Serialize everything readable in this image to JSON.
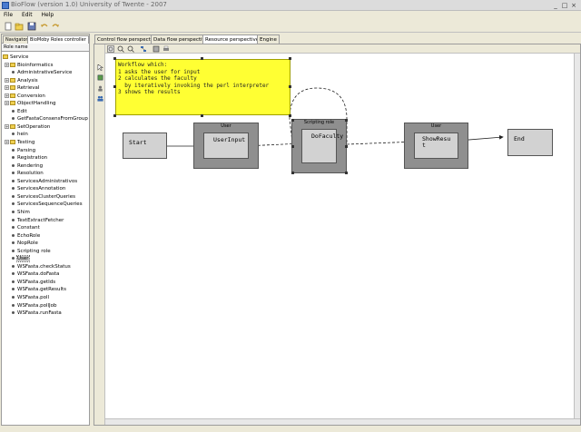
{
  "window": {
    "title": "BioFlow (version 1.0) University of Twente - 2007"
  },
  "menu": {
    "file": "File",
    "edit": "Edit",
    "help": "Help"
  },
  "left_tabs": {
    "navigator": "Navigator",
    "roles": "BioMoby Roles controller"
  },
  "tree": {
    "column_header": "Role name",
    "root": "Service",
    "items": [
      {
        "label": "Bioinformatics",
        "kind": "folder",
        "expandable": true
      },
      {
        "label": "AdministrativeService",
        "kind": "leaf"
      },
      {
        "label": "Analysis",
        "kind": "folder",
        "expandable": true
      },
      {
        "label": "Retrieval",
        "kind": "folder",
        "expandable": true
      },
      {
        "label": "Conversion",
        "kind": "folder",
        "expandable": true
      },
      {
        "label": "ObjectHandling",
        "kind": "folder",
        "expandable": true
      },
      {
        "label": "Edit",
        "kind": "leaf"
      },
      {
        "label": "GetFastaConsensFromGroup",
        "kind": "leaf"
      },
      {
        "label": "SetOperation",
        "kind": "folder",
        "expandable": true
      },
      {
        "label": "hein",
        "kind": "leaf"
      },
      {
        "label": "Testing",
        "kind": "folder",
        "expandable": true
      },
      {
        "label": "Parsing",
        "kind": "leaf"
      },
      {
        "label": "Registration",
        "kind": "leaf"
      },
      {
        "label": "Rendering",
        "kind": "leaf"
      },
      {
        "label": "Resolution",
        "kind": "leaf"
      },
      {
        "label": "ServicesAdministrativos",
        "kind": "leaf"
      },
      {
        "label": "ServicesAnnotation",
        "kind": "leaf"
      },
      {
        "label": "ServicesClusterQueries",
        "kind": "leaf"
      },
      {
        "label": "ServicesSequenceQueries",
        "kind": "leaf"
      },
      {
        "label": "Shim",
        "kind": "leaf"
      },
      {
        "label": "TextExtractFetcher",
        "kind": "leaf"
      },
      {
        "label": "Constant",
        "kind": "leaf"
      },
      {
        "label": "EchoRole",
        "kind": "leaf"
      },
      {
        "label": "NopRole",
        "kind": "leaf"
      },
      {
        "label": "Scripting role",
        "kind": "leaf"
      },
      {
        "label": "User",
        "kind": "leaf",
        "selected": true
      },
      {
        "label": "WSFasta.checkStatus",
        "kind": "leaf"
      },
      {
        "label": "WSFasta.doFasta",
        "kind": "leaf"
      },
      {
        "label": "WSFasta.getIds",
        "kind": "leaf"
      },
      {
        "label": "WSFasta.getResults",
        "kind": "leaf"
      },
      {
        "label": "WSFasta.poll",
        "kind": "leaf"
      },
      {
        "label": "WSFasta.pollJob",
        "kind": "leaf"
      },
      {
        "label": "WSFasta.runFasta",
        "kind": "leaf"
      }
    ]
  },
  "perspectives": {
    "control_flow": "Control flow perspective",
    "data_flow": "Data flow perspective",
    "resource": "Resource perspective",
    "engine": "Engine"
  },
  "note": {
    "text": "Workflow which:\n1 asks the user for input\n2 calculates the faculty\n  by iteratively invoking the perl interpreter\n3 shows the results"
  },
  "workflow": {
    "start": "Start",
    "end": "End",
    "roles": [
      {
        "title": "User",
        "task": "UserInput"
      },
      {
        "title": "Scripting role",
        "task": "DoFaculty"
      },
      {
        "title": "User",
        "task": "ShowResu\nt"
      }
    ]
  },
  "colors": {
    "note_bg": "#ffff33",
    "role_outer": "#8f8f8f",
    "task_inner": "#d2d2d2",
    "selection": "#c8c8c8"
  }
}
